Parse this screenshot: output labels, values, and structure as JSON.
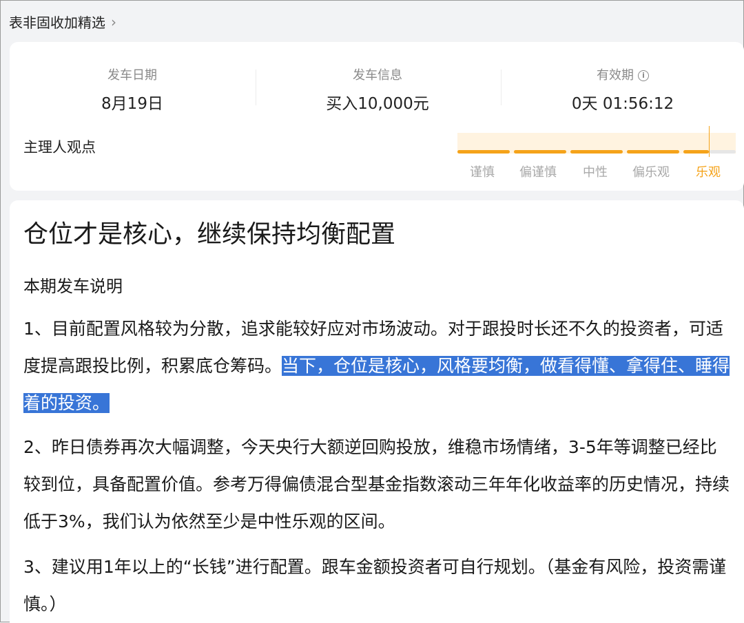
{
  "breadcrumb": {
    "label": "表非固收加精选",
    "chevron": "chevron-right-icon"
  },
  "stats": {
    "date": {
      "label": "发车日期",
      "value": "8月19日"
    },
    "info": {
      "label": "发车信息",
      "value": "买入10,000元"
    },
    "validity": {
      "label": "有效期",
      "value": "0天 01:56:12",
      "icon": "info-icon"
    }
  },
  "opinion": {
    "label": "主理人观点",
    "levels": [
      "谨慎",
      "偏谨慎",
      "中性",
      "偏乐观",
      "乐观"
    ],
    "selected": "乐观",
    "accent": "#f5a31a"
  },
  "article": {
    "headline": "仓位才是核心，继续保持均衡配置",
    "subhead": "本期发车说明",
    "p1_a": "1、目前配置风格较为分散，追求能较好应对市场波动。对于跟投时长还不久的投资者，可适度提高跟投比例，积累底仓筹码。",
    "p1_hl1": "当下，仓位是核心，风格要均",
    "p1_hl2": "衡，做看得懂、拿得住、睡得着的投资。",
    "p2": "2、昨日债券再次大幅调整，今天央行大额逆回购投放，维稳市场情绪，3-5年等调整已经比较到位，具备配置价值。参考万得偏债混合型基金指数滚动三年年化收益率的历史情况，持续低于3%，我们认为依然至少是中性乐观的区间。",
    "p3": "3、建议用1年以上的“长钱”进行配置。跟车金额投资者可自行规划。（基金有风险，投资需谨慎。）",
    "highlight_color": "#3875d7"
  }
}
